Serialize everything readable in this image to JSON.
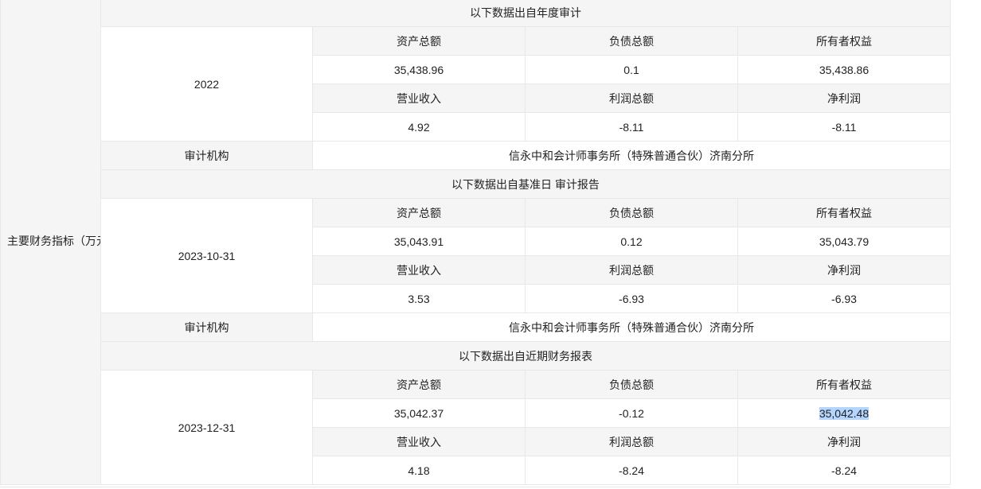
{
  "main_label": "主要财务指标（万元）",
  "headers": {
    "assets": "资产总额",
    "liabilities": "负债总额",
    "equity": "所有者权益",
    "revenue": "营业收入",
    "total_profit": "利润总额",
    "net_profit": "净利润"
  },
  "audit_label": "审计机构",
  "sections": [
    {
      "title": "以下数据出自年度审计",
      "date": "2022",
      "assets": "35,438.96",
      "liabilities": "0.1",
      "equity": "35,438.86",
      "revenue": "4.92",
      "total_profit": "-8.11",
      "net_profit": "-8.11",
      "auditor": "信永中和会计师事务所（特殊普通合伙）济南分所"
    },
    {
      "title": "以下数据出自基准日 审计报告",
      "date": "2023-10-31",
      "assets": "35,043.91",
      "liabilities": "0.12",
      "equity": "35,043.79",
      "revenue": "3.53",
      "total_profit": "-6.93",
      "net_profit": "-6.93",
      "auditor": "信永中和会计师事务所（特殊普通合伙）济南分所"
    },
    {
      "title": "以下数据出自近期财务报表",
      "date": "2023-12-31",
      "assets": "35,042.37",
      "liabilities": "-0.12",
      "equity": "35,042.48",
      "revenue": "4.18",
      "total_profit": "-8.24",
      "net_profit": "-8.24"
    }
  ]
}
